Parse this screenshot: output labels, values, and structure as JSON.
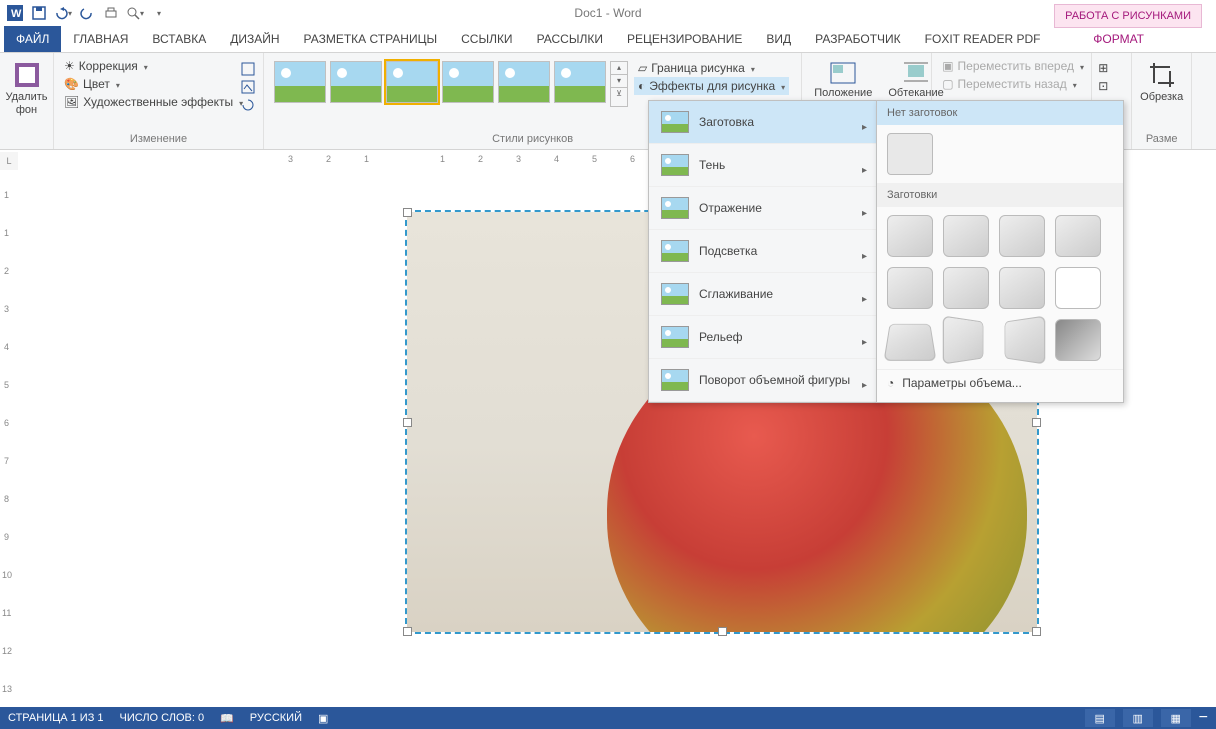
{
  "title": "Doc1 - Word",
  "context_tab": "РАБОТА С РИСУНКАМИ",
  "qat": {
    "word": "W"
  },
  "tabs": {
    "file": "ФАЙЛ",
    "items": [
      "ГЛАВНАЯ",
      "ВСТАВКА",
      "ДИЗАЙН",
      "РАЗМЕТКА СТРАНИЦЫ",
      "ССЫЛКИ",
      "РАССЫЛКИ",
      "РЕЦЕНЗИРОВАНИЕ",
      "ВИД",
      "РАЗРАБОТЧИК",
      "FOXIT READER PDF"
    ],
    "active": "ФОРМАТ"
  },
  "ribbon": {
    "remove_bg": "Удалить\nфон",
    "correction": "Коррекция",
    "color": "Цвет",
    "art_effects": "Художественные эффекты",
    "group_change": "Изменение",
    "group_styles": "Стили рисунков",
    "border": "Граница рисунка",
    "effects": "Эффекты для рисунка",
    "position": "Положение",
    "wrap": "Обтекание",
    "forward": "Переместить вперед",
    "backward": "Переместить назад",
    "crop": "Обрезка",
    "size": "Разме"
  },
  "dropdown": {
    "items": [
      "Заготовка",
      "Тень",
      "Отражение",
      "Подсветка",
      "Сглаживание",
      "Рельеф",
      "Поворот объемной фигуры"
    ]
  },
  "flyout": {
    "none_header": "Нет заготовок",
    "presets_header": "Заготовки",
    "options": "Параметры объема..."
  },
  "status": {
    "page": "СТРАНИЦА 1 ИЗ 1",
    "words": "ЧИСЛО СЛОВ: 0",
    "lang": "РУССКИЙ",
    "minus": "−"
  },
  "ruler_corner": "L"
}
